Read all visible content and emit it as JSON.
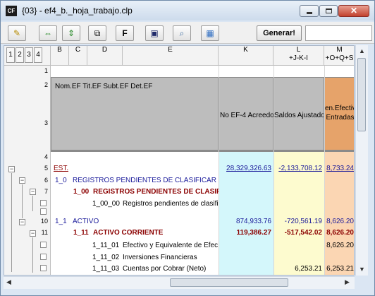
{
  "window": {
    "icon_text": "CF",
    "title": "{03} - ef4_b._hoja_trabajo.clp"
  },
  "toolbar": {
    "buttons": [
      {
        "name": "pencil-icon",
        "glyph": "✎"
      },
      {
        "name": "arrows-horizontal-icon",
        "glyph": "⇔"
      },
      {
        "name": "arrows-vertical-icon",
        "glyph": "⇕"
      },
      {
        "name": "copy-icon",
        "glyph": "⧉"
      },
      {
        "name": "f-button",
        "glyph": "F"
      },
      {
        "name": "save-icon",
        "glyph": "▣"
      },
      {
        "name": "print-preview-icon",
        "glyph": "⌕"
      },
      {
        "name": "table-icon",
        "glyph": "▦"
      }
    ],
    "generate_label": "Generar!"
  },
  "grid": {
    "levels": [
      "1",
      "2",
      "3",
      "4"
    ],
    "columns": {
      "b": "B",
      "c": "C",
      "d": "D",
      "e": "E",
      "k": "K",
      "l": "L",
      "l_formula": "+J-K-I",
      "m": "M",
      "m_formula": "+O+Q+S"
    },
    "rows": {
      "r1": "1",
      "r2": "2",
      "r3": "3",
      "r4": "4",
      "r5": "5",
      "r6": "6",
      "r7": "7",
      "r10": "10",
      "r11": "11"
    },
    "header_row2_text": "Nom.EF  Tit.EF  Subt.EF  Det.EF",
    "header_k": "No EF-4 Acreedor",
    "header_l": "Saldos Ajustados",
    "header_m_1": "en.Efectiv",
    "header_m_2": "Entradas",
    "data": {
      "r5_b": "EST.",
      "r5_k": "28,329,326.63",
      "r5_l": "-2,133,708.12",
      "r5_m": "8,733.24",
      "r6_code": "1_0",
      "r6_name": "REGISTROS PENDIENTES DE CLASIFICAR",
      "r7_code": "1_00",
      "r7_name": "REGISTROS PENDIENTES DE CLASIFIC",
      "r8_code": "1_00_00",
      "r8_name": "Registros pendientes de clasifica",
      "r10_code": "1_1",
      "r10_name": "ACTIVO",
      "r10_k": "874,933.76",
      "r10_l": "-720,561.19",
      "r10_m": "8,626.20",
      "r11_code": "1_11",
      "r11_name": "ACTIVO CORRIENTE",
      "r11_k": "119,386.27",
      "r11_l": "-517,542.02",
      "r11_m": "8,626.20",
      "r12_code": "1_11_01",
      "r12_name": "Efectivo y Equivalente de Efectiv",
      "r12_m": "8,626.20",
      "r13_code": "1_11_02",
      "r13_name": "Inversiones Financieras",
      "r14_code": "1_11_03",
      "r14_name": "Cuentas por Cobrar (Neto)",
      "r14_l": "6,253.21",
      "r14_m": "6,253.21"
    }
  },
  "colors": {
    "col_k_bg": "#d4f7fb",
    "col_l_bg": "#fdfbcf",
    "col_m_bg": "#fbd6b3",
    "header_gray": "#bdbdbd",
    "link_blue": "#1a1a9a",
    "dark_red": "#8b0000",
    "title_bg": "#cddbec"
  }
}
